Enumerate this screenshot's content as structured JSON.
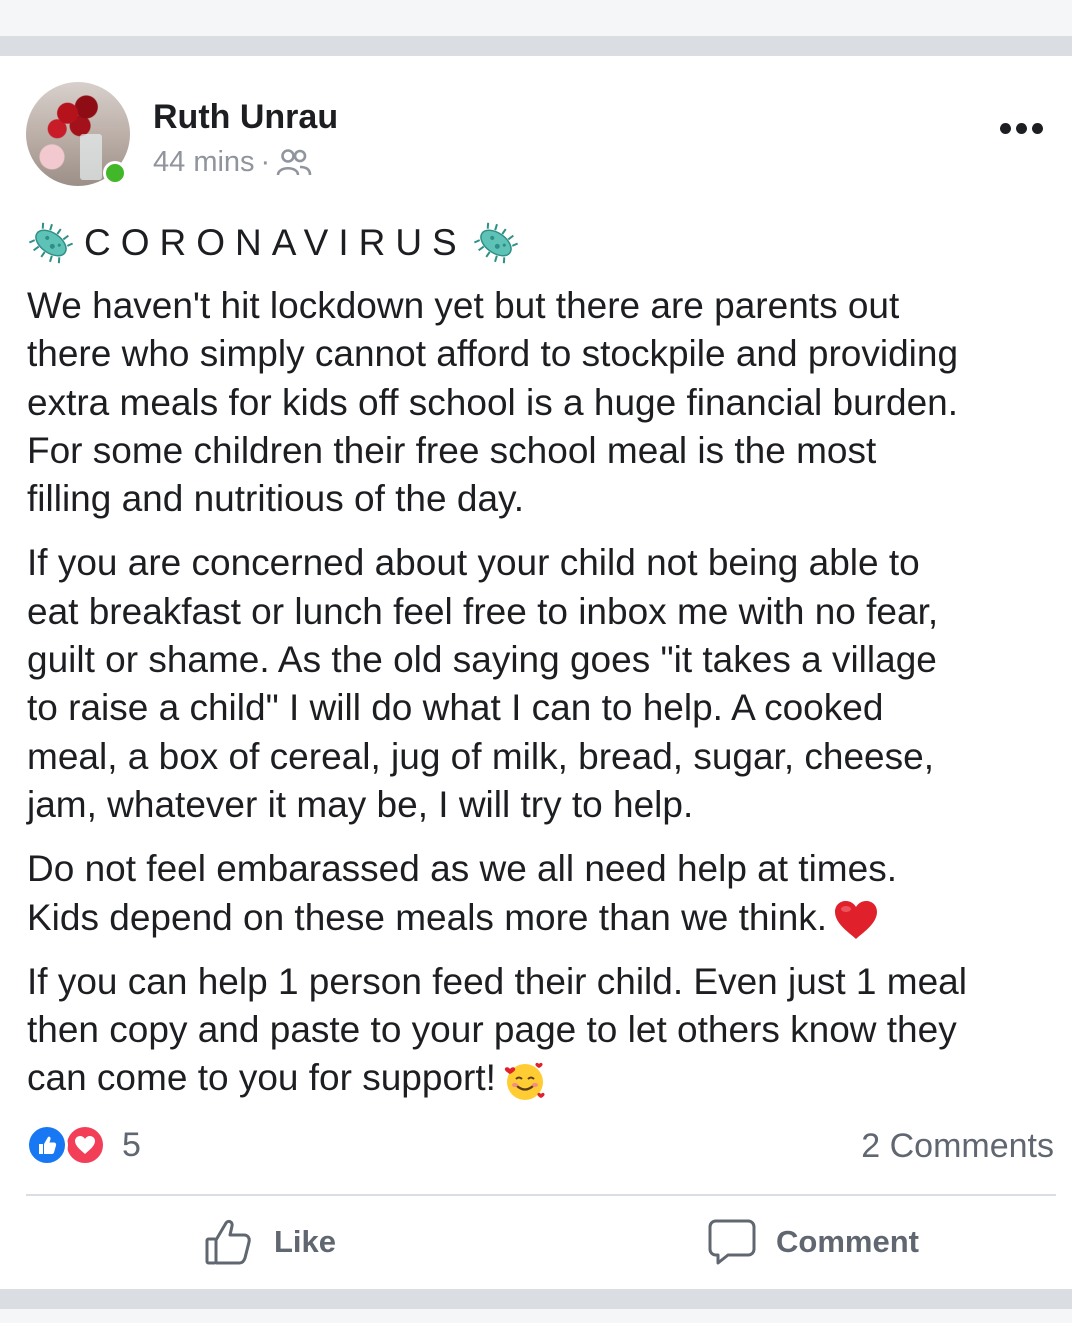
{
  "post": {
    "author": "Ruth Unrau",
    "time": "44 mins",
    "separator": "·",
    "headline": "CORONAVIRUS",
    "paragraphs": [
      [
        "We haven't hit lockdown yet but there are parents out",
        "there who simply cannot afford to stockpile and providing",
        "extra meals for kids off school is a huge financial burden.",
        "For some children their free school meal is the most",
        "filling and nutritious of the day."
      ],
      [
        "If you are concerned about your child not being able to",
        "eat breakfast or lunch feel free to inbox me with no fear,",
        "guilt or shame. As the old saying goes \"it takes a village",
        "to raise a child\" I will do what I can to help. A cooked",
        "meal, a box of cereal, jug of milk, bread, sugar, cheese,",
        "jam, whatever it may be, I will try to help."
      ],
      [
        "Do not feel embarassed as we all need help at times.",
        "Kids depend on these meals more than we think."
      ],
      [
        "If you can help 1 person feed their child. Even just 1 meal",
        "then copy and paste to your page to let others know they",
        "can come to you for support!"
      ]
    ],
    "reaction_count": "5",
    "comments_label": "2 Comments"
  },
  "actions": {
    "like_label": "Like",
    "comment_label": "Comment"
  },
  "icons": {
    "audience": "friends-icon",
    "menu": "more-options-icon",
    "headline_decoration": "microbe-icon",
    "p3_emoji": "red-heart-emoji",
    "p4_emoji": "smiling-face-with-hearts-emoji"
  },
  "colors": {
    "like_blue": "#1877f2",
    "love_red": "#f33e58",
    "online_green": "#42b72a",
    "secondary_text": "#606770"
  }
}
